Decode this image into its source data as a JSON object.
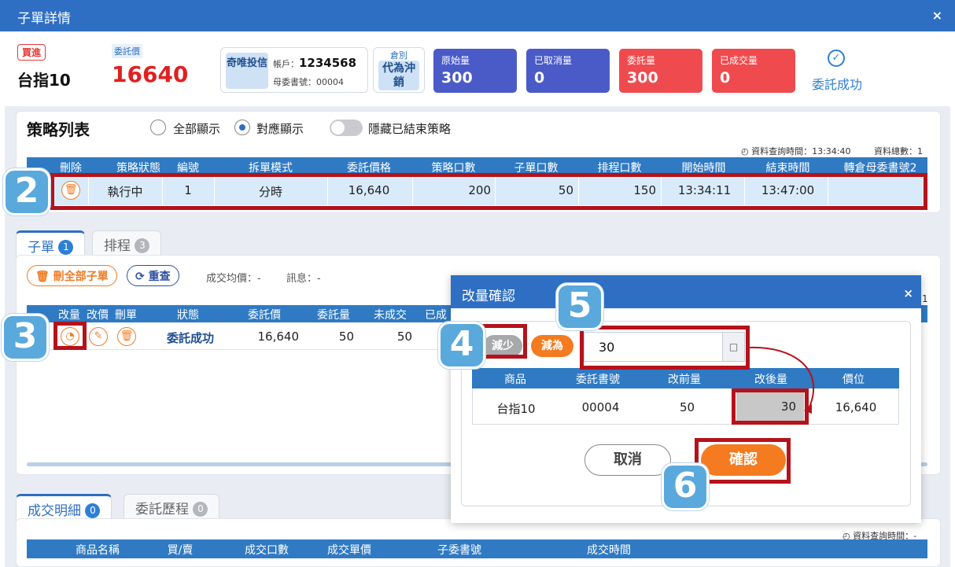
{
  "window": {
    "title": "子單詳情",
    "close_glyph": "×"
  },
  "summary": {
    "side_badge": "買進",
    "symbol": "台指10",
    "price_label": "委託價",
    "price": "16640",
    "investor_type": "奇唯投信",
    "account_label": "帳戶：",
    "account": "1234568",
    "parent_order_label": "母委書號：",
    "parent_order": "00004",
    "position_label": "倉別",
    "position_value": "代為沖銷",
    "quantities": [
      {
        "label": "原始量",
        "value": "300"
      },
      {
        "label": "已取消量",
        "value": "0"
      },
      {
        "label": "委託量",
        "value": "300"
      },
      {
        "label": "已成交量",
        "value": "0"
      }
    ],
    "status": "委託成功"
  },
  "strategy": {
    "title": "策略列表",
    "radio_all": "全部顯示",
    "radio_matched": "對應顯示",
    "toggle_label": "隱藏已結束策略",
    "query_time": "資料查詢時間：13:34:40",
    "total": "資料總數：1",
    "columns": [
      "刪除",
      "策略狀態",
      "編號",
      "拆單模式",
      "委託價格",
      "策略口數",
      "子單口數",
      "排程口數",
      "開始時間",
      "結束時間",
      "轉倉母委書號2"
    ],
    "row": {
      "status": "執行中",
      "id": "1",
      "mode": "分時",
      "price": "16,640",
      "strategy_qty": "200",
      "child_qty": "50",
      "schedule_qty": "150",
      "start": "13:34:11",
      "end": "13:47:00",
      "transfer": ""
    }
  },
  "child_tabs": [
    {
      "label": "子單",
      "count": "1"
    },
    {
      "label": "排程",
      "count": "3"
    }
  ],
  "child_panel": {
    "delete_all": "刪全部子單",
    "requery": "重查",
    "avg_price": "成交均價：-",
    "message": "訊息：-",
    "columns": [
      "改量",
      "改價",
      "刪單",
      "狀態",
      "委託價",
      "委託量",
      "未成交",
      "已成"
    ],
    "row": {
      "status": "委託成功",
      "price": "16,640",
      "qty": "50",
      "unfilled": "50"
    }
  },
  "bottom_tabs": [
    {
      "label": "成交明細",
      "count": "0"
    },
    {
      "label": "委託歷程",
      "count": "0"
    }
  ],
  "bottom_panel": {
    "query_time": "資料查詢時間：-",
    "columns": [
      "商品名稱",
      "買/賣",
      "成交口數",
      "成交單價",
      "子委書號",
      "成交時間"
    ]
  },
  "modal": {
    "title": "改量確認",
    "close_glyph": "×",
    "decrease": "減少",
    "set_to": "減為",
    "quantity_input": "30",
    "input_suffix": "□",
    "columns": [
      "商品",
      "委託書號",
      "改前量",
      "改後量",
      "價位"
    ],
    "row": {
      "product": "台指10",
      "order_no": "00004",
      "before": "50",
      "after": "30",
      "price": "16,640"
    },
    "cancel": "取消",
    "confirm": "確認"
  },
  "steps": [
    "2",
    "3",
    "4",
    "5",
    "6"
  ],
  "stray": {
    "right_digit": "1"
  },
  "colors": {
    "header_blue": "#2e6fc4",
    "accent_orange": "#f47b20",
    "highlight_red": "#b5121b",
    "step_badge": "#5aa9dc"
  }
}
